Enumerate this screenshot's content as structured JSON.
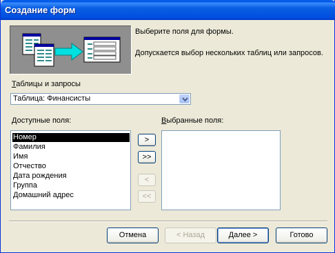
{
  "window": {
    "title": "Создание форм"
  },
  "intro": {
    "line1": "Выберите поля для формы.",
    "line2": "Допускается выбор нескольких таблиц или запросов."
  },
  "source": {
    "label_first": "Т",
    "label_rest": "аблицы и запросы",
    "selected": "Таблица: Финансисты"
  },
  "available": {
    "label_first": "Д",
    "label_rest": "оступные поля:",
    "items": [
      "Номер",
      "Фамилия",
      "Имя",
      "Отчество",
      "Дата рождения",
      "Группа",
      "Домашний адрес"
    ],
    "selected_index": 0
  },
  "chosen": {
    "label_first": "В",
    "label_rest": "ыбранные поля:",
    "items": []
  },
  "move_buttons": {
    "add_one": ">",
    "add_all": ">>",
    "remove_one": "<",
    "remove_all": "<<"
  },
  "buttons": {
    "cancel": "Отмена",
    "back": "< Назад",
    "next_first": "Д",
    "next_rest": "алее >",
    "finish": "Готово"
  },
  "colors": {
    "titlebar": "#0a5fe3",
    "selection": "#000000",
    "face": "#ece9d8"
  }
}
